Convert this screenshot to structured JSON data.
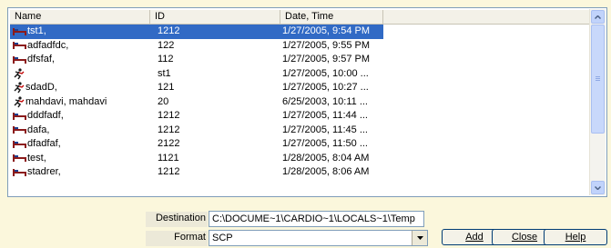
{
  "list": {
    "columns": [
      "Name",
      "ID",
      "Date, Time"
    ],
    "rows": [
      {
        "icon": "bed-icon",
        "name": "tst1,",
        "id": "1212",
        "date": "1/27/2005, 9:54 PM",
        "selected": true
      },
      {
        "icon": "bed-icon",
        "name": "adfadfdc,",
        "id": "122",
        "date": "1/27/2005, 9:55 PM"
      },
      {
        "icon": "bed-icon",
        "name": "dfsfaf,",
        "id": "112",
        "date": "1/27/2005, 9:57 PM"
      },
      {
        "icon": "runner-icon",
        "name": "",
        "id": "st1",
        "date": "1/27/2005, 10:00 ..."
      },
      {
        "icon": "runner-icon",
        "name": "sdadD,",
        "id": "121",
        "date": "1/27/2005, 10:27 ..."
      },
      {
        "icon": "runner-icon",
        "name": "mahdavi, mahdavi",
        "id": "20",
        "date": "6/25/2003, 10:11 ..."
      },
      {
        "icon": "bed-icon",
        "name": "dddfadf,",
        "id": "1212",
        "date": "1/27/2005, 11:44 ..."
      },
      {
        "icon": "bed-icon",
        "name": "dafa,",
        "id": "1212",
        "date": "1/27/2005, 11:45 ..."
      },
      {
        "icon": "bed-icon",
        "name": "dfadfaf,",
        "id": "2122",
        "date": "1/27/2005, 11:50 ..."
      },
      {
        "icon": "bed-icon",
        "name": "test,",
        "id": "1121",
        "date": "1/28/2005, 8:04 AM"
      },
      {
        "icon": "bed-icon",
        "name": "stadrer,",
        "id": "1212",
        "date": "1/28/2005, 8:06 AM"
      }
    ]
  },
  "destination": {
    "label": "Destination",
    "value": "C:\\DOCUME~1\\CARDIO~1\\LOCALS~1\\Temp"
  },
  "format": {
    "label": "Format",
    "value": "SCP"
  },
  "buttons": {
    "add": "Add",
    "close": "Close",
    "help": "Help"
  },
  "colors": {
    "background": "#fbf7dc",
    "selection": "#316ac5",
    "bed_icon": "#8b1a1a",
    "runner_icon": "#1a1a1a"
  }
}
